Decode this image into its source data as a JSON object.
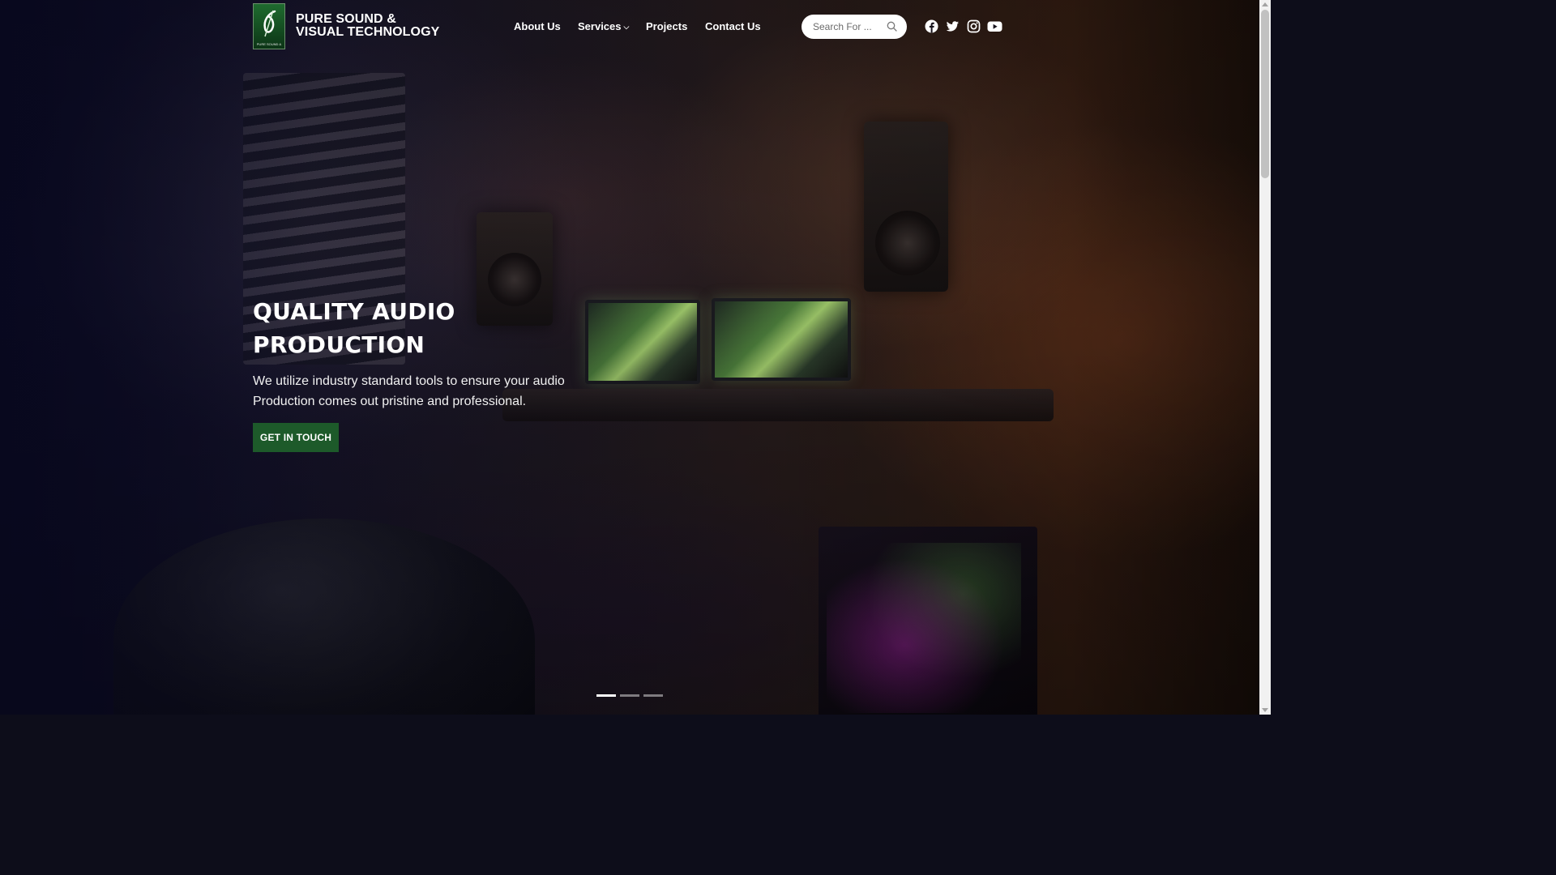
{
  "header": {
    "brand_line1": "PURE SOUND &",
    "brand_line2": "VISUAL TECHNOLOGY",
    "nav": [
      {
        "label": "About Us"
      },
      {
        "label": "Services"
      },
      {
        "label": "Projects"
      },
      {
        "label": "Contact Us"
      }
    ],
    "search_placeholder": "Search For ...",
    "social": [
      "facebook-icon",
      "twitter-icon",
      "instagram-icon",
      "youtube-icon"
    ]
  },
  "hero": {
    "title_line1": "QUALITY AUDIO",
    "title_line2": "PRODUCTION",
    "subtitle": "We utilize industry standard tools to ensure your audio Production comes out pristine and professional.",
    "cta_label": "GET IN TOUCH",
    "slides": 3,
    "active_slide": 1
  },
  "colors": {
    "cta_bg": "#1d5a2a",
    "logo_green": "#1f6b2f",
    "text": "#ffffff"
  }
}
